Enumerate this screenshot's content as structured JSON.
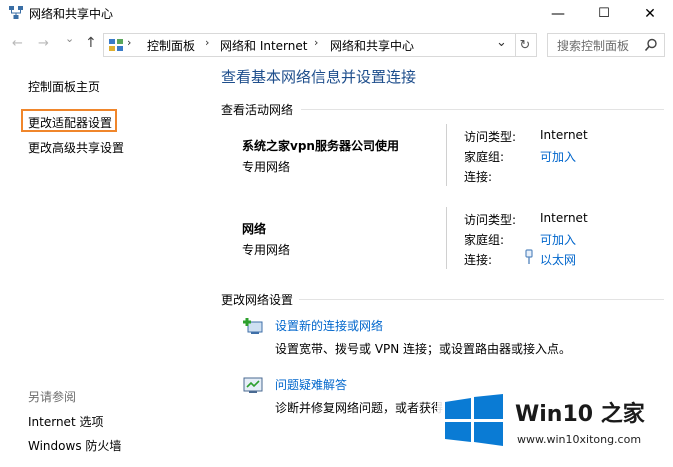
{
  "window": {
    "title": "网络和共享中心",
    "minimize_glyph": "—",
    "maximize_glyph": "☐",
    "close_glyph": "✕"
  },
  "nav": {
    "back_glyph": "←",
    "forward_glyph": "→",
    "dropdown_glyph": "⌄",
    "up_glyph": "↑",
    "refresh_glyph": "↻",
    "breadcrumb": [
      "控制面板",
      "网络和 Internet",
      "网络和共享中心"
    ],
    "crumb_sep": "›",
    "search_placeholder": "搜索控制面板"
  },
  "sidebar": {
    "links": [
      "控制面板主页",
      "更改适配器设置",
      "更改高级共享设置"
    ],
    "see_also_title": "另请参阅",
    "see_also": [
      "Internet 选项",
      "Windows 防火墙"
    ]
  },
  "main": {
    "title": "查看基本网络信息并设置连接",
    "active_section_title": "查看活动网络",
    "networks": [
      {
        "name": "系统之家vpn服务器公司使用",
        "type": "专用网络",
        "access_label": "访问类型:",
        "access_value": "Internet",
        "homegroup_label": "家庭组:",
        "homegroup_value": "可加入",
        "conn_label": "连接:",
        "conn_value": ""
      },
      {
        "name": "网络",
        "type": "专用网络",
        "access_label": "访问类型:",
        "access_value": "Internet",
        "homegroup_label": "家庭组:",
        "homegroup_value": "可加入",
        "conn_label": "连接:",
        "conn_value": "以太网"
      }
    ],
    "change_section_title": "更改网络设置",
    "tasks": [
      {
        "link": "设置新的连接或网络",
        "desc": "设置宽带、拨号或 VPN 连接；或设置路由器或接入点。",
        "icon": "new-connection-icon"
      },
      {
        "link": "问题疑难解答",
        "desc": "诊断并修复网络问题，或者获得",
        "icon": "troubleshoot-icon"
      }
    ]
  },
  "watermark": {
    "brand": "Win10 之家",
    "url": "www.win10xitong.com"
  },
  "colors": {
    "link": "#0066cc",
    "title": "#1e4e8c",
    "highlight": "#f0862b",
    "win_blue": "#0a7bd4"
  }
}
